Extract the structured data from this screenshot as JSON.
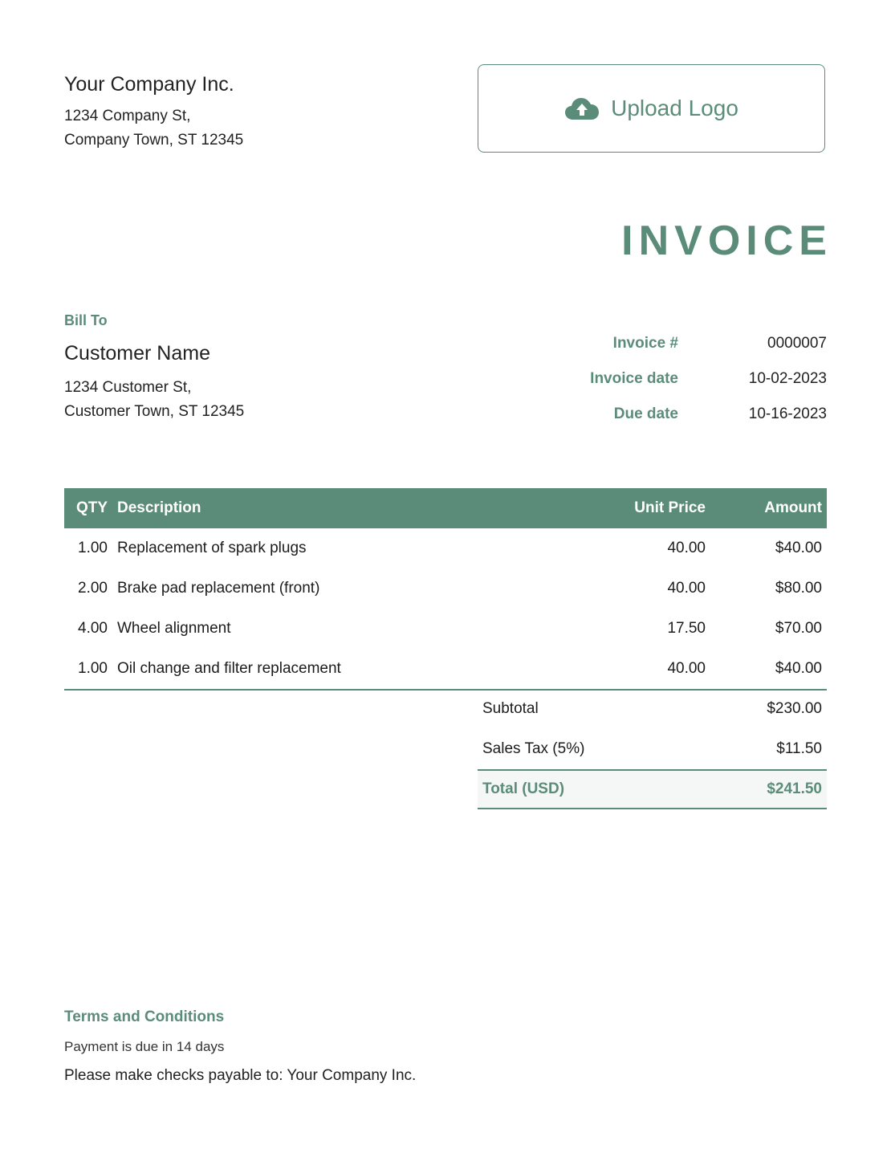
{
  "company": {
    "name": "Your Company Inc.",
    "address_line1": "1234 Company St,",
    "address_line2": "Company Town, ST 12345"
  },
  "upload_logo": {
    "label": "Upload Logo",
    "icon": "cloud-upload-icon"
  },
  "document_title": "INVOICE",
  "bill_to": {
    "label": "Bill To",
    "customer_name": "Customer Name",
    "address_line1": "1234 Customer St,",
    "address_line2": "Customer Town, ST 12345"
  },
  "meta": [
    {
      "label": "Invoice #",
      "value": "0000007"
    },
    {
      "label": "Invoice date",
      "value": "10-02-2023"
    },
    {
      "label": "Due date",
      "value": "10-16-2023"
    }
  ],
  "table": {
    "headers": {
      "qty": "QTY",
      "description": "Description",
      "unit_price": "Unit Price",
      "amount": "Amount"
    },
    "rows": [
      {
        "qty": "1.00",
        "description": "Replacement of spark plugs",
        "unit_price": "40.00",
        "amount": "$40.00"
      },
      {
        "qty": "2.00",
        "description": "Brake pad replacement (front)",
        "unit_price": "40.00",
        "amount": "$80.00"
      },
      {
        "qty": "4.00",
        "description": "Wheel alignment",
        "unit_price": "17.50",
        "amount": "$70.00"
      },
      {
        "qty": "1.00",
        "description": "Oil change and filter replacement",
        "unit_price": "40.00",
        "amount": "$40.00"
      }
    ]
  },
  "totals": {
    "subtotal": {
      "label": "Subtotal",
      "value": "$230.00"
    },
    "tax": {
      "label": "Sales Tax (5%)",
      "value": "$11.50"
    },
    "total": {
      "label": "Total (USD)",
      "value": "$241.50"
    }
  },
  "terms": {
    "label": "Terms and Conditions",
    "line1": "Payment is due in 14 days",
    "line2": "Please make checks payable to: Your Company Inc."
  },
  "colors": {
    "accent": "#5b8c7a",
    "total_bg": "#f5f7f6",
    "text": "#1c1c1c"
  }
}
